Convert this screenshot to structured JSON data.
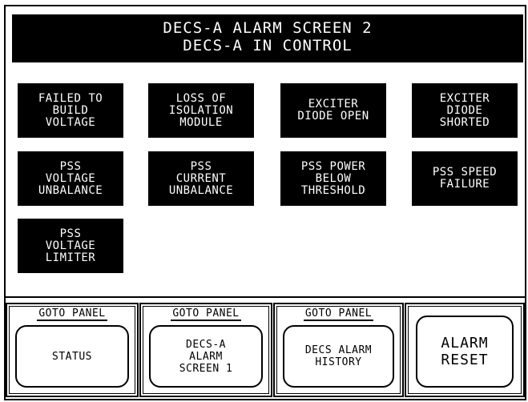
{
  "header": {
    "line1": "DECS-A ALARM SCREEN 2",
    "line2": "DECS-A IN CONTROL"
  },
  "alarms": [
    {
      "label": "FAILED TO\nBUILD\nVOLTAGE"
    },
    {
      "label": "LOSS OF\nISOLATION\nMODULE"
    },
    {
      "label": "EXCITER\nDIODE OPEN"
    },
    {
      "label": "EXCITER\nDIODE\nSHORTED"
    },
    {
      "label": "PSS\nVOLTAGE\nUNBALANCE"
    },
    {
      "label": "PSS\nCURRENT\nUNBALANCE"
    },
    {
      "label": "PSS POWER\nBELOW\nTHRESHOLD"
    },
    {
      "label": "PSS SPEED\nFAILURE"
    },
    {
      "label": "PSS\nVOLTAGE\nLIMITER"
    }
  ],
  "nav": [
    {
      "caption": "GOTO PANEL",
      "button": "STATUS"
    },
    {
      "caption": "GOTO PANEL",
      "button": "DECS-A\nALARM\nSCREEN 1"
    },
    {
      "caption": "GOTO PANEL",
      "button": "DECS ALARM\nHISTORY"
    }
  ],
  "reset": {
    "label": "ALARM\nRESET"
  },
  "colors": {
    "background": "#ffffff",
    "foreground": "#000000",
    "alarm_text": "#ffffff"
  }
}
